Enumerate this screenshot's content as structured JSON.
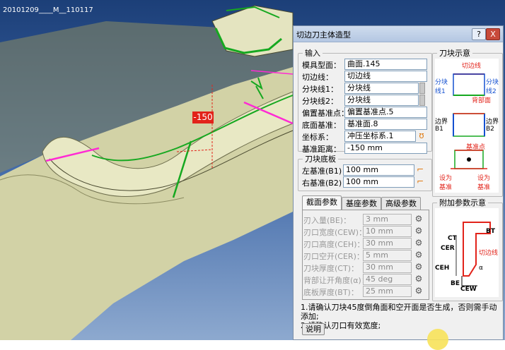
{
  "viewport": {
    "title": "20101209____M__110117",
    "dimension_label": "-150"
  },
  "dialog": {
    "title": "切边刀主体造型",
    "help_btn": "?",
    "close_btn": "X",
    "input_group": {
      "legend": "输入",
      "fields": [
        {
          "label": "模具型面：",
          "value": "曲面.145"
        },
        {
          "label": "切边线：",
          "value": "切边线"
        },
        {
          "label": "分块线1：",
          "value": "分块线"
        },
        {
          "label": "分块线2：",
          "value": "分块线"
        },
        {
          "label": "偏置基准点：",
          "value": "偏置基准点.5"
        },
        {
          "label": "底面基准：",
          "value": "基准面.8"
        },
        {
          "label": "坐标系：",
          "value": "冲压坐标系.1"
        },
        {
          "label": "基准距离：",
          "value": "-150 mm"
        }
      ]
    },
    "base_group": {
      "legend": "刀块底板",
      "fields": [
        {
          "label": "左基准(B1)：",
          "value": "100 mm"
        },
        {
          "label": "右基准(B2)：",
          "value": "100 mm"
        }
      ]
    },
    "tabs": [
      "截面参数",
      "基座参数",
      "高级参数"
    ],
    "section_params": [
      {
        "label": "刃入量(BE)：",
        "value": "3 mm"
      },
      {
        "label": "刃口宽度(CEW)：",
        "value": "10 mm"
      },
      {
        "label": "刃口高度(CEH)：",
        "value": "30 mm"
      },
      {
        "label": "刃口空开(CER)：",
        "value": "5 mm"
      },
      {
        "label": "刀块厚度(CT)：",
        "value": "30 mm"
      },
      {
        "label": "背部让开角度(α)：",
        "value": "45 deg"
      },
      {
        "label": "底板厚度(BT)：",
        "value": "25 mm"
      }
    ],
    "diagram_group": {
      "legend": "刀块示意",
      "labels": {
        "trim_line": "切边线",
        "split1": "分块\n线1",
        "split2": "分块\n线2",
        "back_face": "背部面",
        "bound_b1": "边界\nB1",
        "bound_b2": "边界\nB2",
        "base_point": "基准点",
        "set_base_left": "设为\n基准",
        "set_base_right": "设为\n基准"
      }
    },
    "extra_group": {
      "legend": "附加参数示意",
      "labels": {
        "ct": "CT",
        "bt": "BT",
        "cer": "CER",
        "trim_line": "切边线",
        "ceh": "CEH",
        "alpha": "α",
        "be": "BE",
        "cew": "CEW"
      }
    },
    "notes": [
      "1.请确认刀块45度倒角面和空开面是否生成，否则需手动添加;",
      "2.请确认刃口有效宽度;"
    ],
    "explain_btn": "说明"
  }
}
